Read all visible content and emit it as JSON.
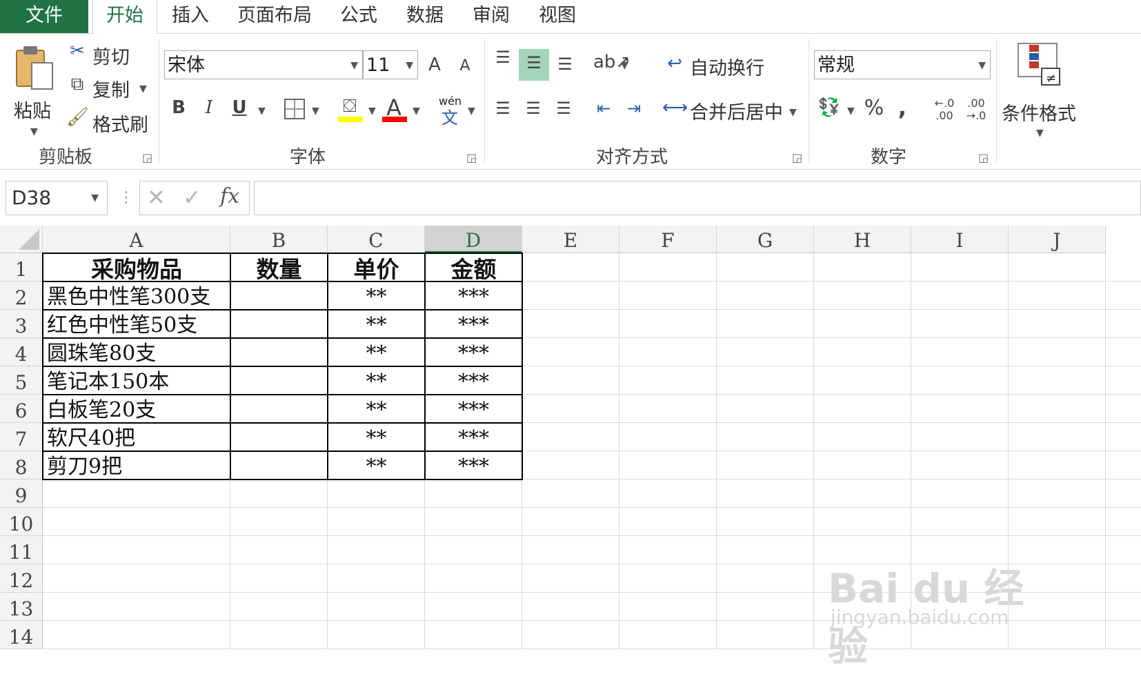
{
  "tabs": [
    "文件",
    "开始",
    "插入",
    "页面布局",
    "公式",
    "数据",
    "审阅",
    "视图"
  ],
  "clipboard": {
    "paste": "粘贴",
    "cut": "剪切",
    "copy": "复制",
    "format_painter": "格式刷",
    "label": "剪贴板"
  },
  "font": {
    "name": "宋体",
    "size": "11",
    "bold": "B",
    "italic": "I",
    "underline": "U",
    "grow": "A",
    "shrink": "A",
    "label": "字体",
    "phonetic": "wén",
    "phonetic_char": "文",
    "font_color": "A"
  },
  "alignment": {
    "wrap": "自动换行",
    "merge": "合并后居中",
    "label": "对齐方式"
  },
  "number": {
    "format": "常规",
    "percent": "%",
    "comma": ",",
    "label": "数字",
    "inc_decimal": "←.0\n.00",
    "dec_decimal": ".00\n→.0"
  },
  "styles": {
    "conditional": "条件格式"
  },
  "formula_bar": {
    "name_box": "D38",
    "fx": "fx",
    "value": ""
  },
  "columns": [
    "A",
    "B",
    "C",
    "D",
    "E",
    "F",
    "G",
    "H",
    "I",
    "J"
  ],
  "rows": [
    "1",
    "2",
    "3",
    "4",
    "5",
    "6",
    "7",
    "8",
    "9",
    "10",
    "11",
    "12",
    "13",
    "14"
  ],
  "table": {
    "header": [
      "采购物品",
      "数量",
      "单价",
      "金额"
    ],
    "items": [
      [
        "黑色中性笔300支",
        "",
        "**",
        "***"
      ],
      [
        "红色中性笔50支",
        "",
        "**",
        "***"
      ],
      [
        "圆珠笔80支",
        "",
        "**",
        "***"
      ],
      [
        "笔记本150本",
        "",
        "**",
        "***"
      ],
      [
        "白板笔20支",
        "",
        "**",
        "***"
      ],
      [
        "软尺40把",
        "",
        "**",
        "***"
      ],
      [
        "剪刀9把",
        "",
        "**",
        "***"
      ]
    ]
  },
  "watermark": {
    "brand": "Bai du 经验",
    "url": "jingyan.baidu.com"
  },
  "colors": {
    "accent": "#217346",
    "highlight": "#FFFF00",
    "font_red": "#FF0000",
    "selected_align": "#A3D6B8"
  }
}
